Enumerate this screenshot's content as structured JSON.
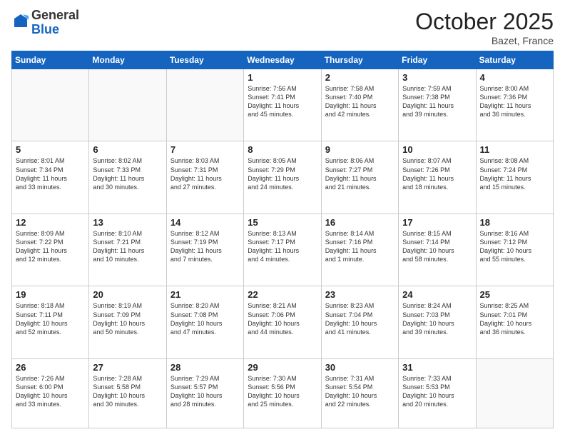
{
  "logo": {
    "general": "General",
    "blue": "Blue"
  },
  "header": {
    "month": "October 2025",
    "location": "Bazet, France"
  },
  "weekdays": [
    "Sunday",
    "Monday",
    "Tuesday",
    "Wednesday",
    "Thursday",
    "Friday",
    "Saturday"
  ],
  "weeks": [
    [
      {
        "day": "",
        "info": ""
      },
      {
        "day": "",
        "info": ""
      },
      {
        "day": "",
        "info": ""
      },
      {
        "day": "1",
        "info": "Sunrise: 7:56 AM\nSunset: 7:41 PM\nDaylight: 11 hours\nand 45 minutes."
      },
      {
        "day": "2",
        "info": "Sunrise: 7:58 AM\nSunset: 7:40 PM\nDaylight: 11 hours\nand 42 minutes."
      },
      {
        "day": "3",
        "info": "Sunrise: 7:59 AM\nSunset: 7:38 PM\nDaylight: 11 hours\nand 39 minutes."
      },
      {
        "day": "4",
        "info": "Sunrise: 8:00 AM\nSunset: 7:36 PM\nDaylight: 11 hours\nand 36 minutes."
      }
    ],
    [
      {
        "day": "5",
        "info": "Sunrise: 8:01 AM\nSunset: 7:34 PM\nDaylight: 11 hours\nand 33 minutes."
      },
      {
        "day": "6",
        "info": "Sunrise: 8:02 AM\nSunset: 7:33 PM\nDaylight: 11 hours\nand 30 minutes."
      },
      {
        "day": "7",
        "info": "Sunrise: 8:03 AM\nSunset: 7:31 PM\nDaylight: 11 hours\nand 27 minutes."
      },
      {
        "day": "8",
        "info": "Sunrise: 8:05 AM\nSunset: 7:29 PM\nDaylight: 11 hours\nand 24 minutes."
      },
      {
        "day": "9",
        "info": "Sunrise: 8:06 AM\nSunset: 7:27 PM\nDaylight: 11 hours\nand 21 minutes."
      },
      {
        "day": "10",
        "info": "Sunrise: 8:07 AM\nSunset: 7:26 PM\nDaylight: 11 hours\nand 18 minutes."
      },
      {
        "day": "11",
        "info": "Sunrise: 8:08 AM\nSunset: 7:24 PM\nDaylight: 11 hours\nand 15 minutes."
      }
    ],
    [
      {
        "day": "12",
        "info": "Sunrise: 8:09 AM\nSunset: 7:22 PM\nDaylight: 11 hours\nand 12 minutes."
      },
      {
        "day": "13",
        "info": "Sunrise: 8:10 AM\nSunset: 7:21 PM\nDaylight: 11 hours\nand 10 minutes."
      },
      {
        "day": "14",
        "info": "Sunrise: 8:12 AM\nSunset: 7:19 PM\nDaylight: 11 hours\nand 7 minutes."
      },
      {
        "day": "15",
        "info": "Sunrise: 8:13 AM\nSunset: 7:17 PM\nDaylight: 11 hours\nand 4 minutes."
      },
      {
        "day": "16",
        "info": "Sunrise: 8:14 AM\nSunset: 7:16 PM\nDaylight: 11 hours\nand 1 minute."
      },
      {
        "day": "17",
        "info": "Sunrise: 8:15 AM\nSunset: 7:14 PM\nDaylight: 10 hours\nand 58 minutes."
      },
      {
        "day": "18",
        "info": "Sunrise: 8:16 AM\nSunset: 7:12 PM\nDaylight: 10 hours\nand 55 minutes."
      }
    ],
    [
      {
        "day": "19",
        "info": "Sunrise: 8:18 AM\nSunset: 7:11 PM\nDaylight: 10 hours\nand 52 minutes."
      },
      {
        "day": "20",
        "info": "Sunrise: 8:19 AM\nSunset: 7:09 PM\nDaylight: 10 hours\nand 50 minutes."
      },
      {
        "day": "21",
        "info": "Sunrise: 8:20 AM\nSunset: 7:08 PM\nDaylight: 10 hours\nand 47 minutes."
      },
      {
        "day": "22",
        "info": "Sunrise: 8:21 AM\nSunset: 7:06 PM\nDaylight: 10 hours\nand 44 minutes."
      },
      {
        "day": "23",
        "info": "Sunrise: 8:23 AM\nSunset: 7:04 PM\nDaylight: 10 hours\nand 41 minutes."
      },
      {
        "day": "24",
        "info": "Sunrise: 8:24 AM\nSunset: 7:03 PM\nDaylight: 10 hours\nand 39 minutes."
      },
      {
        "day": "25",
        "info": "Sunrise: 8:25 AM\nSunset: 7:01 PM\nDaylight: 10 hours\nand 36 minutes."
      }
    ],
    [
      {
        "day": "26",
        "info": "Sunrise: 7:26 AM\nSunset: 6:00 PM\nDaylight: 10 hours\nand 33 minutes."
      },
      {
        "day": "27",
        "info": "Sunrise: 7:28 AM\nSunset: 5:58 PM\nDaylight: 10 hours\nand 30 minutes."
      },
      {
        "day": "28",
        "info": "Sunrise: 7:29 AM\nSunset: 5:57 PM\nDaylight: 10 hours\nand 28 minutes."
      },
      {
        "day": "29",
        "info": "Sunrise: 7:30 AM\nSunset: 5:56 PM\nDaylight: 10 hours\nand 25 minutes."
      },
      {
        "day": "30",
        "info": "Sunrise: 7:31 AM\nSunset: 5:54 PM\nDaylight: 10 hours\nand 22 minutes."
      },
      {
        "day": "31",
        "info": "Sunrise: 7:33 AM\nSunset: 5:53 PM\nDaylight: 10 hours\nand 20 minutes."
      },
      {
        "day": "",
        "info": ""
      }
    ]
  ]
}
